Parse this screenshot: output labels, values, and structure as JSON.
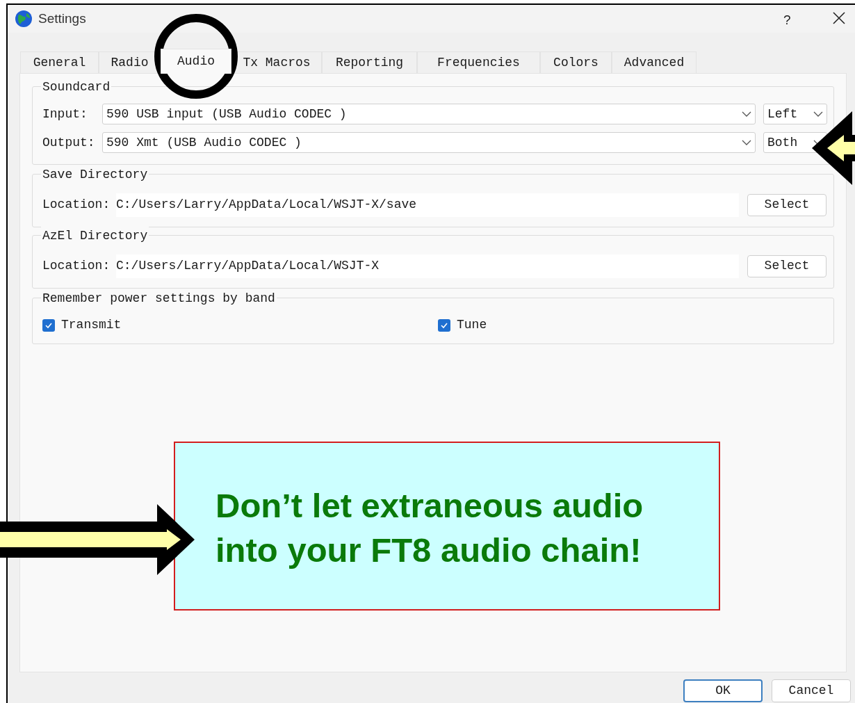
{
  "window": {
    "title": "Settings",
    "help": "?"
  },
  "tabs": [
    {
      "label": "General",
      "selected": false
    },
    {
      "label": "Radio",
      "selected": false
    },
    {
      "label": "Audio",
      "selected": true
    },
    {
      "label": "Tx Macros",
      "selected": false
    },
    {
      "label": "Reporting",
      "selected": false
    },
    {
      "label": "Frequencies",
      "selected": false
    },
    {
      "label": "Colors",
      "selected": false
    },
    {
      "label": "Advanced",
      "selected": false
    }
  ],
  "soundcard": {
    "title": "Soundcard",
    "rows": [
      {
        "label": "Input:",
        "device": "590 USB input (USB Audio CODEC )",
        "channel": "Left"
      },
      {
        "label": "Output:",
        "device": "590 Xmt (USB Audio CODEC )",
        "channel": "Both"
      }
    ]
  },
  "directories": [
    {
      "title": "Save Directory",
      "label": "Location:",
      "path": "C:/Users/Larry/AppData/Local/WSJT-X/save",
      "button": "Select"
    },
    {
      "title": "AzEl Directory",
      "label": "Location:",
      "path": "C:/Users/Larry/AppData/Local/WSJT-X",
      "button": "Select"
    }
  ],
  "power": {
    "title": "Remember power settings by band",
    "options": [
      {
        "label": "Transmit",
        "checked": true
      },
      {
        "label": "Tune",
        "checked": true
      }
    ]
  },
  "callout": {
    "text": "Don’t let extraneous audio into your FT8 audio chain!"
  },
  "buttons": [
    {
      "label": "OK",
      "default": true
    },
    {
      "label": "Cancel",
      "default": false
    }
  ]
}
